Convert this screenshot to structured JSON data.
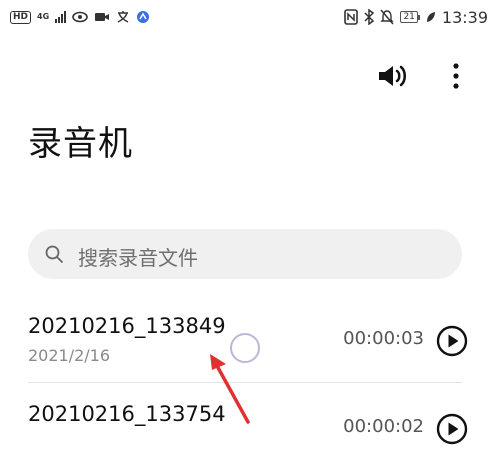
{
  "status_bar": {
    "hd": "HD",
    "net_top": "4G",
    "net_bottom": "HD",
    "battery": "21",
    "time": "13:39"
  },
  "app": {
    "title": "录音机"
  },
  "search": {
    "placeholder": "搜索录音文件"
  },
  "recordings": [
    {
      "name": "20210216_133849",
      "date": "2021/2/16",
      "duration": "00:00:03"
    },
    {
      "name": "20210216_133754",
      "date": "",
      "duration": "00:00:02"
    }
  ],
  "colors": {
    "accent_annotation": "#e03030"
  }
}
